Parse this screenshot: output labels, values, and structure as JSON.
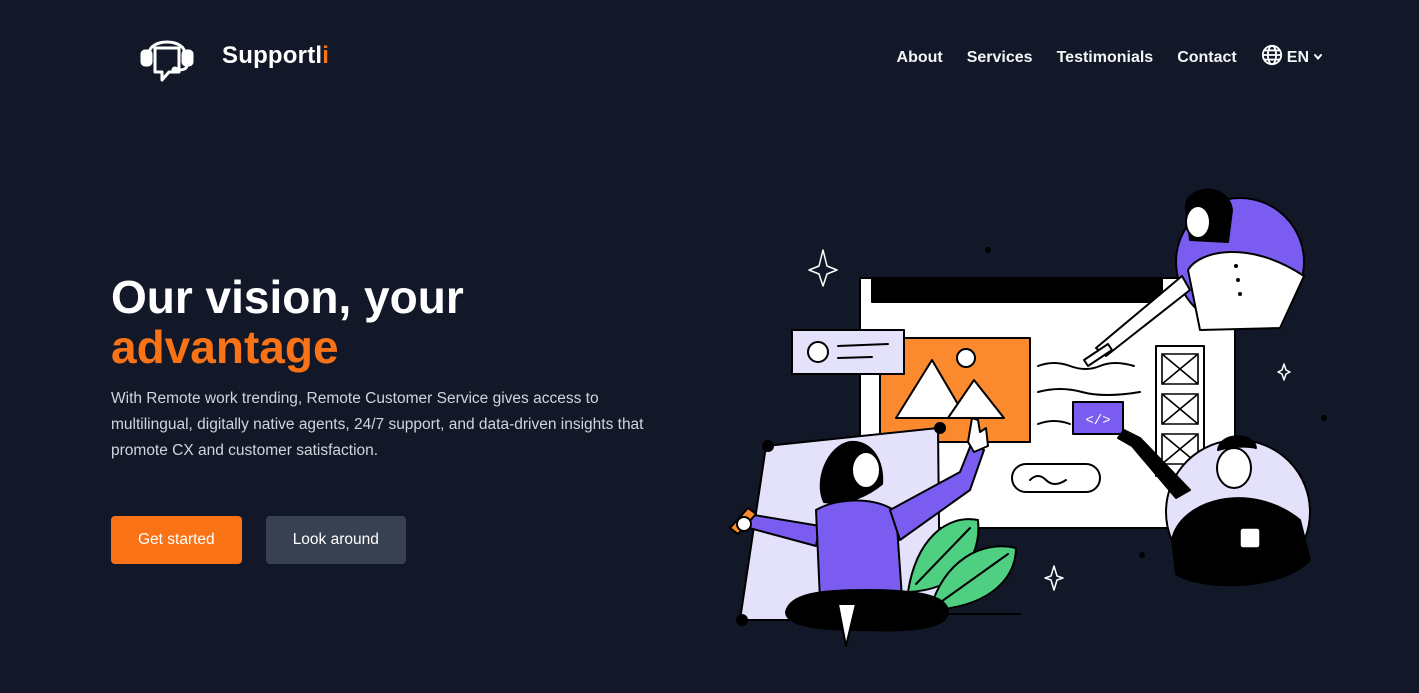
{
  "brand": {
    "name": "Supportl",
    "accent_letter": "i"
  },
  "nav": {
    "items": [
      "About",
      "Services",
      "Testimonials",
      "Contact"
    ],
    "language": "EN"
  },
  "hero": {
    "title_line1": "Our vision, your",
    "title_line2": "advantage",
    "description": "With Remote work trending, Remote Customer Service gives access to multilingual, digitally native agents, 24/7 support, and data-driven insights that promote CX and customer satisfaction."
  },
  "buttons": {
    "primary": "Get started",
    "secondary": "Look around"
  },
  "illustration": {
    "code_tag": "</>"
  },
  "colors": {
    "background": "#121828",
    "accent": "#f97316",
    "secondary_button": "#374151",
    "purple": "#7b5cf0"
  },
  "icons": [
    "headset-chat-icon",
    "globe-icon",
    "chevron-down-icon"
  ]
}
